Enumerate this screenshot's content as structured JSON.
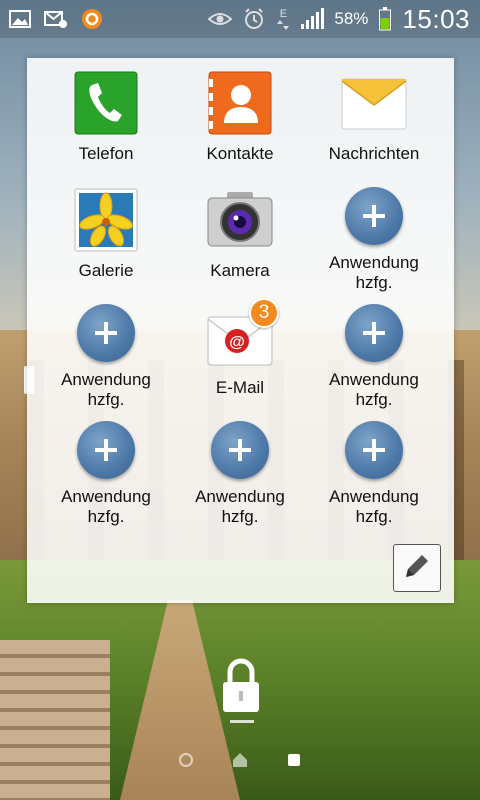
{
  "status_bar": {
    "battery_percent": "58%",
    "time": "15:03",
    "network_type": "E",
    "icons": [
      "image-icon",
      "email-notification-icon",
      "app-notification-icon",
      "eye-icon",
      "alarm-icon",
      "data-arrows-icon",
      "signal-icon",
      "battery-icon"
    ]
  },
  "apps": [
    {
      "label": "Telefon",
      "icon": "phone-icon"
    },
    {
      "label": "Kontakte",
      "icon": "contacts-icon"
    },
    {
      "label": "Nachrichten",
      "icon": "messages-icon"
    },
    {
      "label": "Galerie",
      "icon": "gallery-icon"
    },
    {
      "label": "Kamera",
      "icon": "camera-icon"
    },
    {
      "label": "Anwendung\nhzfg.",
      "icon": "add-icon"
    },
    {
      "label": "Anwendung\nhzfg.",
      "icon": "add-icon"
    },
    {
      "label": "E-Mail",
      "icon": "email-icon",
      "badge": "3"
    },
    {
      "label": "Anwendung\nhzfg.",
      "icon": "add-icon"
    },
    {
      "label": "Anwendung\nhzfg.",
      "icon": "add-icon"
    },
    {
      "label": "Anwendung\nhzfg.",
      "icon": "add-icon"
    },
    {
      "label": "Anwendung\nhzfg.",
      "icon": "add-icon"
    }
  ],
  "colors": {
    "phone": "#2aa32a",
    "contacts": "#f06a1e",
    "messages": "#f5c23a",
    "add_button": "#4c78a8",
    "email_badge": "#f28a1e",
    "battery": "#7fd000"
  }
}
